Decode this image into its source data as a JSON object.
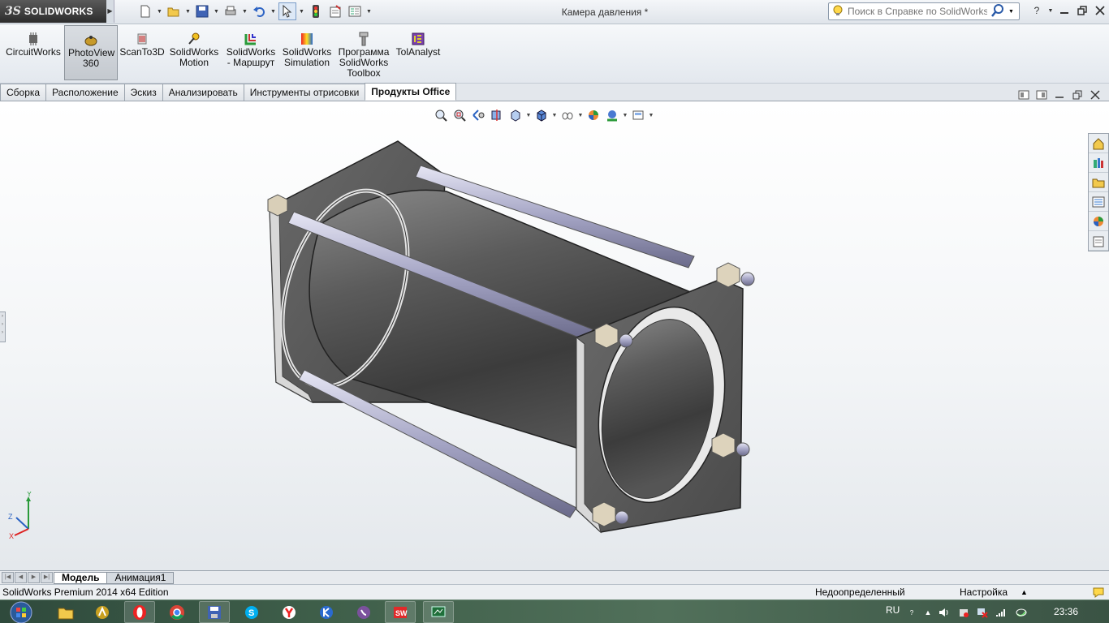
{
  "app": {
    "brand_prefix": "3S",
    "brand": "SOLIDWORKS",
    "document_title": "Камера давления *"
  },
  "help_search": {
    "placeholder": "Поиск в Справке по SolidWorks"
  },
  "command_manager": {
    "items": [
      {
        "label": "CircuitWorks",
        "icon": "chip-icon"
      },
      {
        "label": "PhotoView 360",
        "icon": "photoview-teapot-icon"
      },
      {
        "label": "ScanTo3D",
        "icon": "scan-icon"
      },
      {
        "label": "SolidWorks Motion",
        "icon": "motion-icon"
      },
      {
        "label": "SolidWorks - Маршрут",
        "icon": "routing-icon"
      },
      {
        "label": "SolidWorks Simulation",
        "icon": "simulation-cube-icon"
      },
      {
        "label": "Программа SolidWorks Toolbox",
        "icon": "toolbox-bolt-icon"
      },
      {
        "label": "TolAnalyst",
        "icon": "tolanalyst-icon"
      }
    ]
  },
  "tabs": [
    {
      "label": "Сборка"
    },
    {
      "label": "Расположение"
    },
    {
      "label": "Эскиз"
    },
    {
      "label": "Анализировать"
    },
    {
      "label": "Инструменты отрисовки"
    },
    {
      "label": "Продукты Office"
    }
  ],
  "active_tab": "Продукты Office",
  "triad": {
    "x": "X",
    "y": "Y",
    "z": "Z"
  },
  "bottom_tabs": [
    {
      "label": "Модель"
    },
    {
      "label": "Анимация1"
    }
  ],
  "status": {
    "product": "SolidWorks Premium 2014 x64 Edition",
    "definition": "Недоопределенный",
    "settings": "Настройка",
    "settings_arrow": "▲"
  },
  "taskbar": {
    "lang": "RU",
    "time": "23:36"
  },
  "colors": {
    "accent": "#e22a2a",
    "viewport_top": "#ffffff",
    "viewport_bottom": "#e4e8ec"
  }
}
